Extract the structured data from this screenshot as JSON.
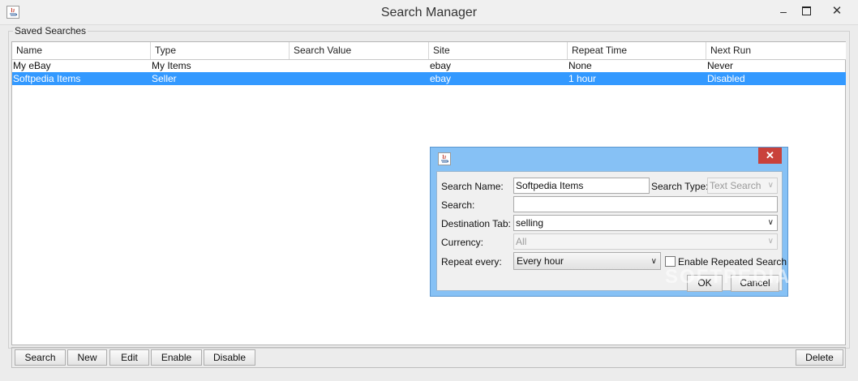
{
  "window": {
    "title": "Search Manager"
  },
  "group": {
    "label": "Saved Searches"
  },
  "table": {
    "columns": [
      "Name",
      "Type",
      "Search Value",
      "Site",
      "Repeat Time",
      "Next Run"
    ],
    "rows": [
      {
        "name": "My eBay",
        "type": "My Items",
        "search_value": "",
        "site": "ebay",
        "repeat_time": "None",
        "next_run": "Never",
        "selected": false
      },
      {
        "name": "Softpedia Items",
        "type": "Seller",
        "search_value": "",
        "site": "ebay",
        "repeat_time": "1 hour",
        "next_run": "Disabled",
        "selected": true
      }
    ]
  },
  "buttons": {
    "search": "Search",
    "new": "New",
    "edit": "Edit",
    "enable": "Enable",
    "disable": "Disable",
    "delete": "Delete"
  },
  "dialog": {
    "search_name_label": "Search Name:",
    "search_name_value": "Softpedia Items",
    "search_type_label": "Search Type:",
    "search_type_value": "Text Search",
    "search_label": "Search:",
    "search_value": "",
    "destination_label": "Destination Tab:",
    "destination_value": "selling",
    "currency_label": "Currency:",
    "currency_value": "All",
    "repeat_label": "Repeat every:",
    "repeat_value": "Every hour",
    "enable_repeated_label": "Enable Repeated Search",
    "enable_repeated_checked": false,
    "ok_label": "OK",
    "cancel_label": "Cancel"
  },
  "watermark": "SOFTPEDIA",
  "colors": {
    "selection": "#3399ff",
    "dialog_frame": "#86c1f5",
    "close_button": "#c9413b"
  }
}
